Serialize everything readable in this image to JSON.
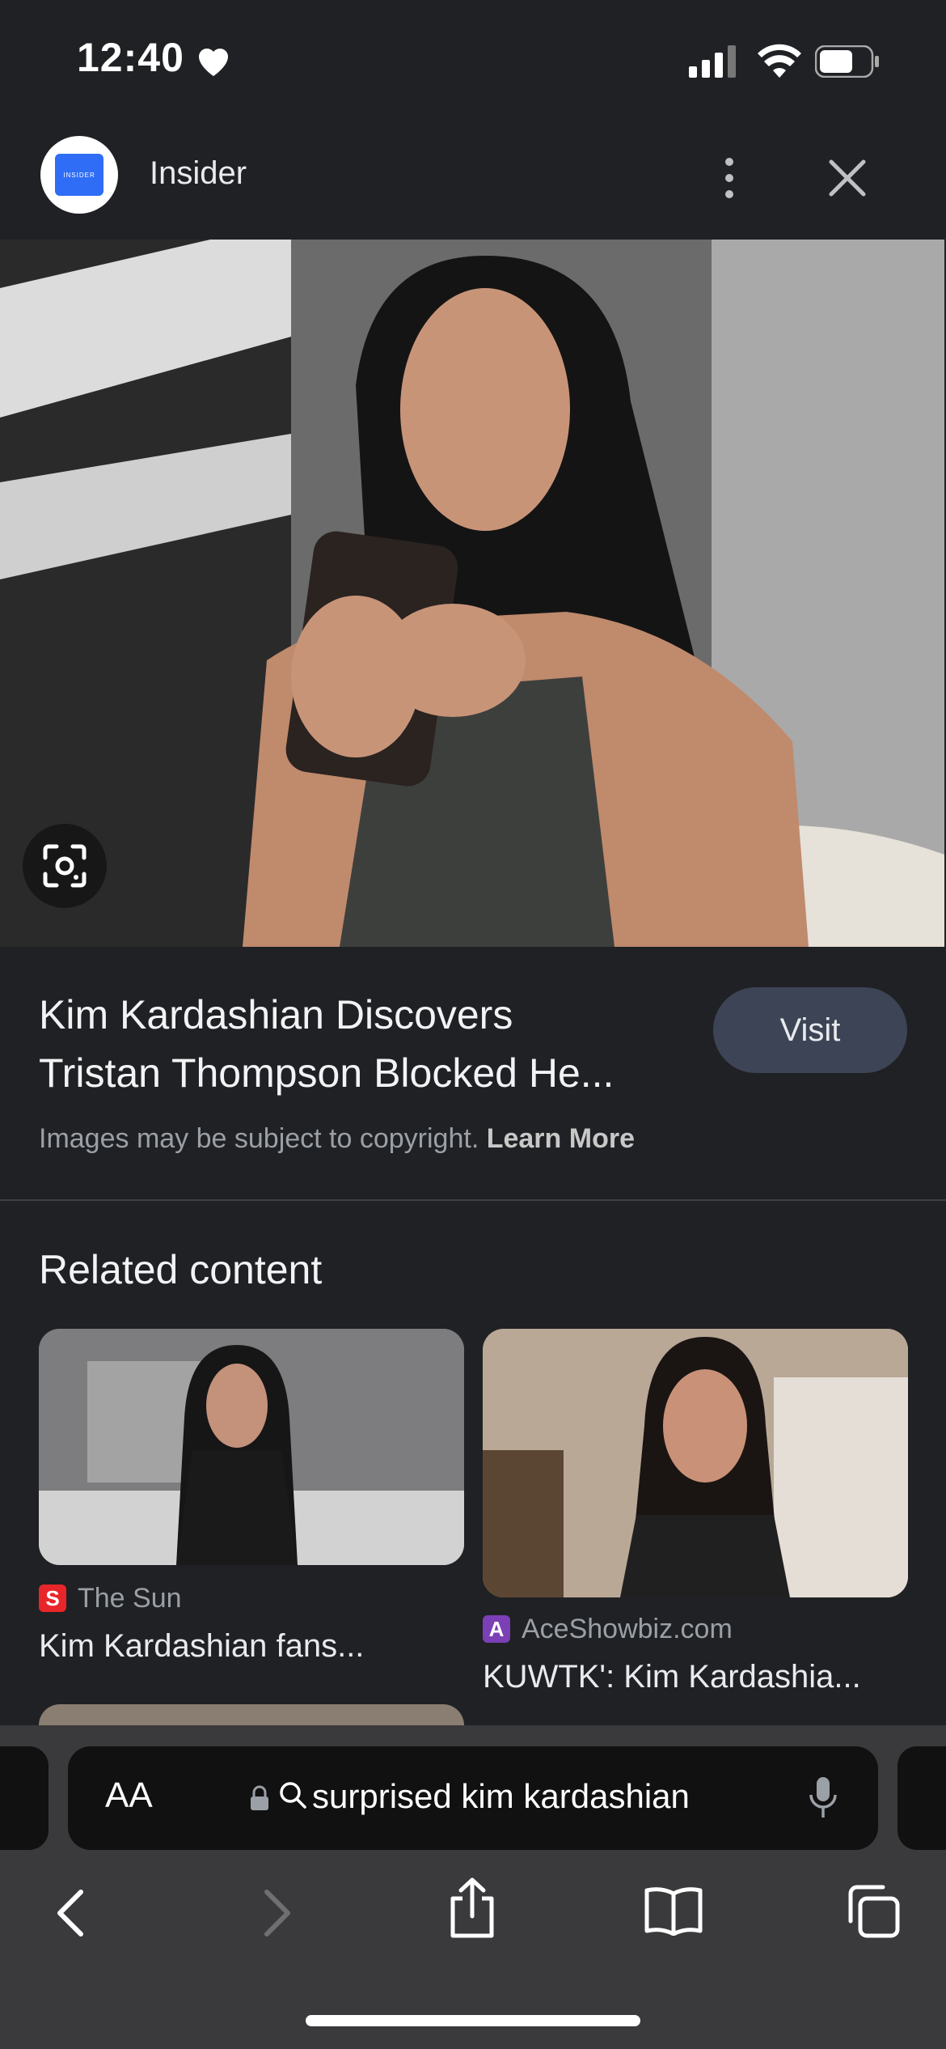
{
  "status_bar": {
    "time": "12:40"
  },
  "header": {
    "source_name": "Insider",
    "logo_text": "INSIDER"
  },
  "result": {
    "title_line1": "Kim Kardashian Discovers",
    "title_line2": "Tristan Thompson Blocked He...",
    "visit_label": "Visit",
    "copyright_text": "Images may be subject to copyright.",
    "learn_more": "Learn More"
  },
  "related": {
    "heading": "Related content",
    "cards": [
      {
        "source_icon_letter": "S",
        "source": "The Sun",
        "title": "Kim Kardashian fans..."
      },
      {
        "source_icon_letter": "A",
        "source": "AceShowbiz.com",
        "title": "KUWTK': Kim Kardashia..."
      }
    ]
  },
  "browser": {
    "aa_label": "AA",
    "url": "surprised kim kardashian"
  },
  "colors": {
    "accent": "#3c4455",
    "background": "#202124",
    "sun_red": "#e8262a",
    "ace_purple": "#7b3fb6"
  }
}
